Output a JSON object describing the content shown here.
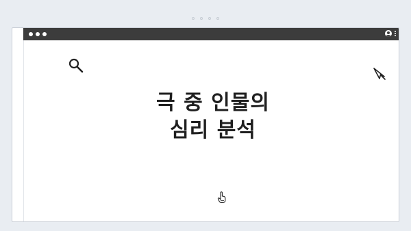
{
  "window": {
    "title_dots": [
      "red",
      "yellow",
      "green"
    ]
  },
  "content": {
    "heading_lines": [
      "극 중 인물의",
      "심리 분석"
    ]
  },
  "icons": {
    "search": "search-icon",
    "cursor": "cursor-icon",
    "pointer": "hand-pointer-icon",
    "user": "user-icon",
    "menu": "kebab-menu-icon"
  },
  "colors": {
    "background": "#e9edf2",
    "titlebar": "#3c3c3c",
    "window": "#ffffff",
    "text": "#1f1f1f"
  }
}
